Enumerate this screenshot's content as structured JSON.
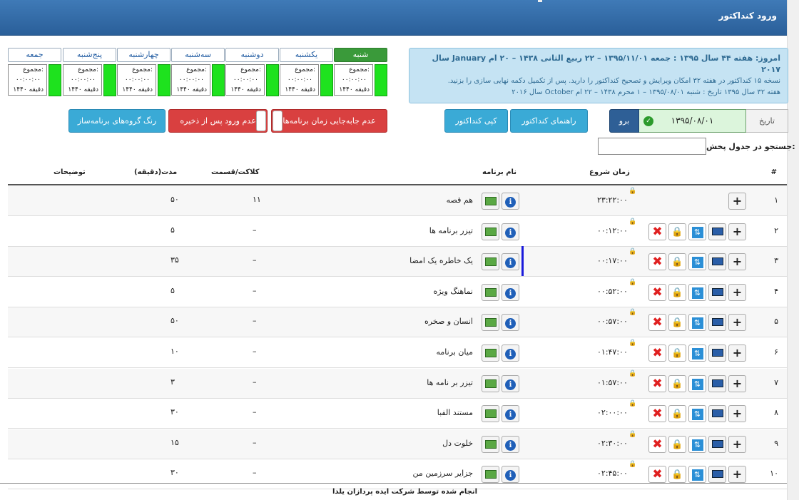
{
  "header": {
    "title": "ورود کنداکتور"
  },
  "days": [
    {
      "label": "جمعه",
      "total_label": "مجموع:",
      "total_value": "۰۰:۰۰:۰۰",
      "minutes": "۱۴۴۰ دقیقه",
      "active": false
    },
    {
      "label": "پنج‌شنبه",
      "total_label": "مجموع:",
      "total_value": "۰۰:۰۰:۰۰",
      "minutes": "۱۴۴۰ دقیقه",
      "active": false
    },
    {
      "label": "چهارشنبه",
      "total_label": "مجموع:",
      "total_value": "۰۰:۰۰:۰۰",
      "minutes": "۱۴۴۰ دقیقه",
      "active": false
    },
    {
      "label": "سه‌شنبه",
      "total_label": "مجموع:",
      "total_value": "۰۰:۰۰:۰۰",
      "minutes": "۱۴۴۰ دقیقه",
      "active": false
    },
    {
      "label": "دوشنبه",
      "total_label": "مجموع:",
      "total_value": "۰۰:۰۰:۰۰",
      "minutes": "۱۴۴۰ دقیقه",
      "active": false
    },
    {
      "label": "یکشنبه",
      "total_label": "مجموع:",
      "total_value": "۰۰:۰۰:۰۰",
      "minutes": "۱۴۴۰ دقیقه",
      "active": false
    },
    {
      "label": "شنبه",
      "total_label": "مجموع:",
      "total_value": "۰۰:۰۰:۰۰",
      "minutes": "۱۴۴۰ دقیقه",
      "active": true
    }
  ],
  "info": {
    "line1": "امروز: هفته ۴۴ سال ۱۳۹۵ : جمعه ۱۳۹۵/۱۱/۰۱ – ۲۲ ربیع الثانی ۱۴۳۸ – ۲۰ ام January سال ۲۰۱۷",
    "line2": "نسخه ۱۵ کنداکتور در هفته ۳۲ امکان ویرایش و تصحیح کنداکتور را دارید. پس از تکمیل دکمه نهایی سازی را بزنید.",
    "line3": "هفته ۳۲ سال ۱۳۹۵ تاریخ : شنبه ۱۳۹۵/۰۸/۰۱ – ۱ محرم ۱۴۳۸ – ۲۲ ام October سال ۲۰۱۶"
  },
  "buttons": {
    "no_move": "عدم جابه‌جایی زمان برنامه‌ها",
    "no_entry": "عدم ورود پس از ذخیره",
    "group_colors": "رنگ گروه‌های برنامه‌ساز",
    "guide": "راهنمای کنداکتور",
    "copy": "کپی کنداکتور",
    "go": "برو"
  },
  "date": {
    "label": "تاریخ",
    "value": "۱۳۹۵/۰۸/۰۱"
  },
  "search": {
    "label": "جستجو در جدول پخش:",
    "value": ""
  },
  "table": {
    "headers": {
      "num": "#",
      "start": "زمان شروع",
      "name": "نام برنامه",
      "parts": "کلاکت/قسمت",
      "duration": "مدت(دقیقه)",
      "notes": "توضیحات"
    },
    "rows": [
      {
        "num": "۱",
        "start": "۲۳:۲۲:۰۰",
        "name": "هم قصه",
        "parts": "۱۱",
        "duration": "۵۰"
      },
      {
        "num": "۲",
        "start": "۰۰:۱۲:۰۰",
        "name": "تیزر برنامه ها",
        "parts": "–",
        "duration": "۵"
      },
      {
        "num": "۳",
        "start": "۰۰:۱۷:۰۰",
        "name": "یک خاطره یک امضا",
        "parts": "–",
        "duration": "۳۵"
      },
      {
        "num": "۴",
        "start": "۰۰:۵۲:۰۰",
        "name": "نماهنگ ویژه",
        "parts": "–",
        "duration": "۵"
      },
      {
        "num": "۵",
        "start": "۰۰:۵۷:۰۰",
        "name": "انسان و صخره",
        "parts": "–",
        "duration": "۵۰"
      },
      {
        "num": "۶",
        "start": "۰۱:۴۷:۰۰",
        "name": "میان برنامه",
        "parts": "–",
        "duration": "۱۰"
      },
      {
        "num": "۷",
        "start": "۰۱:۵۷:۰۰",
        "name": "تیزر بر نامه ها",
        "parts": "–",
        "duration": "۳"
      },
      {
        "num": "۸",
        "start": "۰۲:۰۰:۰۰",
        "name": "مستند الفبا",
        "parts": "–",
        "duration": "۳۰"
      },
      {
        "num": "۹",
        "start": "۰۲:۳۰:۰۰",
        "name": "خلوت دل",
        "parts": "–",
        "duration": "۱۵"
      },
      {
        "num": "۱۰",
        "start": "۰۲:۴۵:۰۰",
        "name": "جزایر سرزمین من",
        "parts": "–",
        "duration": "۳۰"
      }
    ]
  },
  "footer": {
    "text": "انجام شده توسط شرکت ایده پردازان یلدا"
  }
}
